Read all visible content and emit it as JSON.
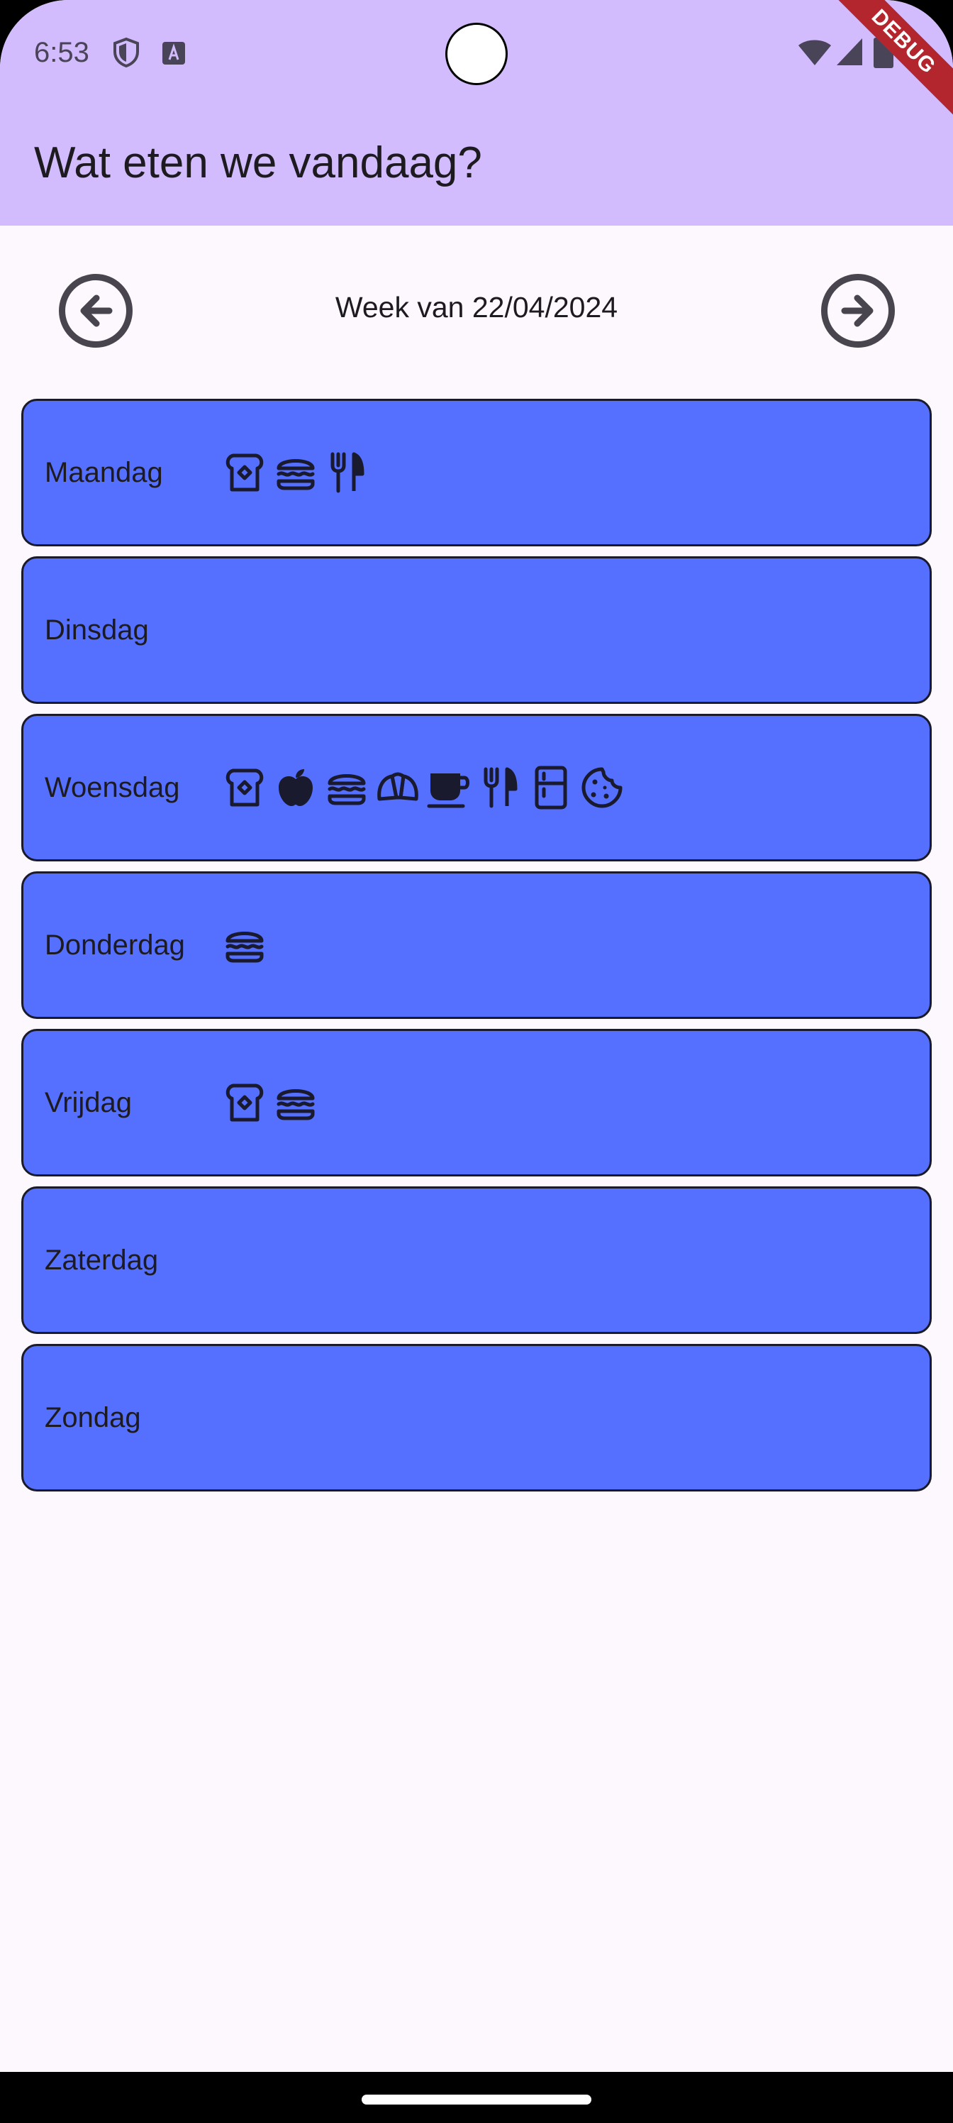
{
  "status_bar": {
    "time": "6:53",
    "icons": [
      "shield-icon",
      "accessibility-a-icon",
      "wifi-icon",
      "signal-icon",
      "battery-icon"
    ]
  },
  "debug_banner": "DEBUG",
  "app_bar": {
    "title": "Wat eten we vandaag?"
  },
  "week_nav": {
    "label": "Week van 22/04/2024",
    "prev_icon": "arrow-left-circle-icon",
    "next_icon": "arrow-right-circle-icon"
  },
  "days": [
    {
      "label": "Maandag",
      "icons": [
        "toast",
        "burger",
        "utensils"
      ]
    },
    {
      "label": "Dinsdag",
      "icons": []
    },
    {
      "label": "Woensdag",
      "icons": [
        "toast",
        "apple",
        "burger",
        "croissant",
        "coffee",
        "utensils",
        "fridge",
        "cookie"
      ]
    },
    {
      "label": "Donderdag",
      "icons": [
        "burger"
      ]
    },
    {
      "label": "Vrijdag",
      "icons": [
        "toast",
        "burger"
      ]
    },
    {
      "label": "Zaterdag",
      "icons": []
    },
    {
      "label": "Zondag",
      "icons": []
    }
  ],
  "colors": {
    "app_bar": "#d2bcfd",
    "background": "#fdf7fe",
    "day_card": "#5570fe",
    "debug": "#b3262e"
  }
}
